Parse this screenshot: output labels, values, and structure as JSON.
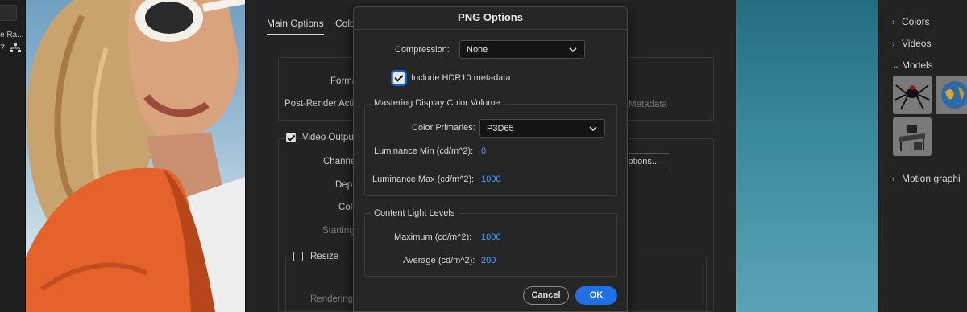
{
  "left_panel": {
    "truncated_label": "e Ra...",
    "count": "7"
  },
  "export_dialog": {
    "tabs": [
      "Main Options",
      "Colo"
    ],
    "labels": {
      "format": "Forma",
      "post_render": "Post-Render Actio",
      "metadata": "Metadata",
      "video_output": "Video Output",
      "channels": "Channe",
      "depth": "Dept",
      "color": "Colo",
      "starting": "Starting",
      "resize": "Resize",
      "rendering": "Rendering"
    },
    "options_button": "Options..."
  },
  "png_options": {
    "title": "PNG Options",
    "compression_label": "Compression:",
    "compression_value": "None",
    "hdr_checkbox_label": "Include HDR10 metadata",
    "hdr_checked": true,
    "mastering_group": "Mastering Display Color Volume",
    "color_primaries_label": "Color Primaries:",
    "color_primaries_value": "P3D65",
    "lum_min_label": "Luminance Min (cd/m^2):",
    "lum_min_value": "0",
    "lum_max_label": "Luminance Max (cd/m^2):",
    "lum_max_value": "1000",
    "content_group": "Content Light Levels",
    "maximum_label": "Maximum (cd/m^2):",
    "maximum_value": "1000",
    "average_label": "Average (cd/m^2):",
    "average_value": "200",
    "cancel_label": "Cancel",
    "ok_label": "OK"
  },
  "right_panel": {
    "items": [
      {
        "label": "Colors",
        "chevron": "right"
      },
      {
        "label": "Videos",
        "chevron": "right"
      },
      {
        "label": "Models",
        "chevron": "down"
      },
      {
        "label": "Motion graphi",
        "chevron": "right"
      }
    ]
  },
  "colors": {
    "accent": "#1f6fe6",
    "value_blue": "#4a9ff5",
    "panel": "#232323",
    "modal": "#262626"
  }
}
